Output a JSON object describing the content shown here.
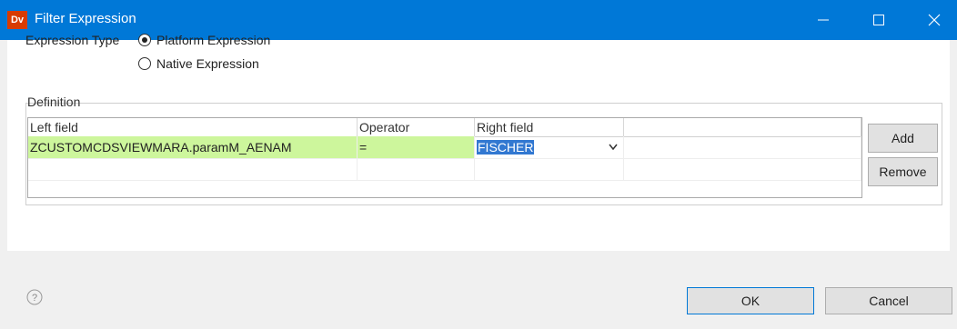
{
  "window": {
    "app_icon_text": "Dv",
    "title": "Filter Expression"
  },
  "expression_type": {
    "label": "Expression Type",
    "options": [
      {
        "label": "Platform Expression",
        "selected": true
      },
      {
        "label": "Native Expression",
        "selected": false
      }
    ]
  },
  "definition": {
    "group_label": "Definition",
    "columns": [
      "Left field",
      "Operator",
      "Right field",
      ""
    ],
    "rows": [
      {
        "left_field": "ZCUSTOMCDSVIEWMARA.paramM_AENAM",
        "operator": "=",
        "right_field": "FISCHER"
      }
    ],
    "add_label": "Add",
    "remove_label": "Remove"
  },
  "footer": {
    "ok_label": "OK",
    "cancel_label": "Cancel",
    "help_icon": "help-icon"
  },
  "colors": {
    "titlebar": "#0078d7",
    "row_highlight": "#cdf69c",
    "selection": "#3278d1"
  }
}
